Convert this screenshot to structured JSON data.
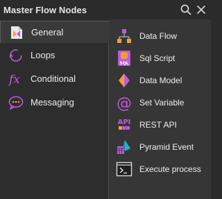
{
  "header": {
    "title": "Master Flow Nodes",
    "search_icon": "search-icon",
    "close_icon": "close-icon"
  },
  "sidebar": {
    "items": [
      {
        "label": "General",
        "icon": "general-icon",
        "active": true
      },
      {
        "label": "Loops",
        "icon": "loop-icon",
        "active": false
      },
      {
        "label": "Conditional",
        "icon": "fx-icon",
        "active": false
      },
      {
        "label": "Messaging",
        "icon": "message-icon",
        "active": false
      }
    ]
  },
  "nodes": {
    "items": [
      {
        "label": "Data Flow",
        "icon": "data-flow-icon"
      },
      {
        "label": "Sql Script",
        "icon": "sql-script-icon",
        "icon_text": "SQL"
      },
      {
        "label": "Data Model",
        "icon": "data-model-icon"
      },
      {
        "label": "Set Variable",
        "icon": "at-sign-icon",
        "icon_text": "@"
      },
      {
        "label": "REST API",
        "icon": "rest-api-icon",
        "icon_text": "API"
      },
      {
        "label": "Pyramid Event",
        "icon": "pyramid-event-icon"
      },
      {
        "label": "Execute process",
        "icon": "terminal-icon"
      }
    ]
  },
  "colors": {
    "accent_purple": "#c05ae0",
    "accent_orange": "#f0a030",
    "accent_teal": "#28b0c8",
    "panel_bg": "#363636",
    "sidebar_bg": "#2d2d2d"
  }
}
